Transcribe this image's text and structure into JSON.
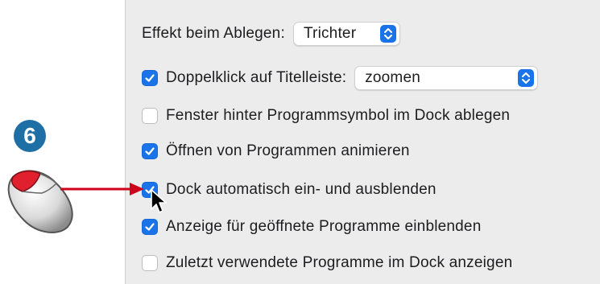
{
  "step_badge": "6",
  "settings": {
    "effect": {
      "label": "Effekt beim Ablegen:",
      "value": "Trichter"
    },
    "double_click": {
      "checked": true,
      "label": "Doppelklick auf Titelleiste:",
      "value": "zoomen"
    },
    "checkboxes": [
      {
        "checked": false,
        "label": "Fenster hinter Programmsymbol im Dock ablegen"
      },
      {
        "checked": true,
        "label": "Öffnen von Programmen animieren"
      },
      {
        "checked": true,
        "label": "Dock automatisch ein- und ausblenden"
      },
      {
        "checked": true,
        "label": "Anzeige für geöffnete Programme einblenden"
      },
      {
        "checked": false,
        "label": "Zuletzt verwendete Programme im Dock anzeigen"
      }
    ]
  },
  "colors": {
    "accent": "#1a73e8",
    "panel": "#ececec",
    "badge": "#1e6fa6",
    "arrow": "#d0021b"
  },
  "icons": [
    "mouse-icon",
    "arrow-icon",
    "cursor-icon",
    "checkmark-icon",
    "stepper-icon"
  ]
}
